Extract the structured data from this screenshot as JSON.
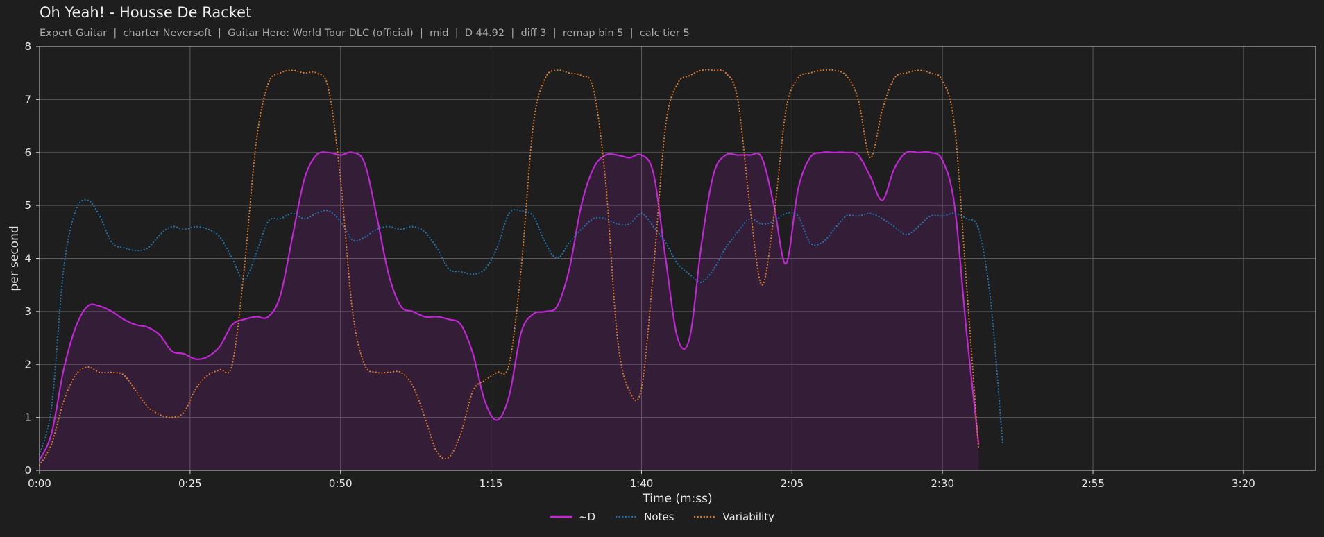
{
  "title": "Oh Yeah! - Housse De Racket",
  "subtitle": "Expert Guitar  |  charter Neversoft  |  Guitar Hero: World Tour DLC (official)  |  mid  |  D 44.92  |  diff 3  |  remap bin 5  |  calc tier 5",
  "chart_data": {
    "type": "line",
    "xlabel": "Time (m:ss)",
    "ylabel": "per second",
    "xlim": [
      0,
      212
    ],
    "ylim": [
      0,
      8
    ],
    "xticks": [
      0,
      25,
      50,
      75,
      100,
      125,
      150,
      175,
      200
    ],
    "xtick_labels": [
      "0:00",
      "0:25",
      "0:50",
      "1:15",
      "1:40",
      "2:05",
      "2:30",
      "2:55",
      "3:20"
    ],
    "yticks": [
      0,
      1,
      2,
      3,
      4,
      5,
      6,
      7,
      8
    ],
    "grid": true,
    "legend_position": "bottom-center",
    "x": [
      0,
      2,
      4,
      6,
      8,
      10,
      12,
      14,
      16,
      18,
      20,
      22,
      24,
      26,
      28,
      30,
      32,
      34,
      36,
      38,
      40,
      42,
      44,
      46,
      48,
      50,
      52,
      54,
      56,
      58,
      60,
      62,
      64,
      66,
      68,
      70,
      72,
      74,
      76,
      78,
      80,
      82,
      84,
      86,
      88,
      90,
      92,
      94,
      96,
      98,
      100,
      102,
      104,
      106,
      108,
      110,
      112,
      114,
      116,
      118,
      120,
      122,
      124,
      126,
      128,
      130,
      132,
      134,
      136,
      138,
      140,
      142,
      144,
      146,
      148,
      150,
      152,
      154,
      156,
      158,
      160,
      162,
      164,
      166,
      168,
      170,
      172,
      174,
      176,
      178,
      180,
      182,
      184,
      186,
      188,
      190,
      192,
      194,
      196,
      198,
      200,
      202,
      204,
      206,
      208,
      210,
      212
    ],
    "series": [
      {
        "name": "~D",
        "color": "#c026d3",
        "style": "solid",
        "fill": true,
        "values": [
          0.2,
          0.7,
          1.9,
          2.7,
          3.1,
          3.1,
          3.0,
          2.85,
          2.75,
          2.7,
          2.55,
          2.25,
          2.2,
          2.1,
          2.15,
          2.35,
          2.75,
          2.85,
          2.9,
          2.9,
          3.3,
          4.4,
          5.5,
          5.95,
          6.0,
          5.95,
          6.0,
          5.8,
          4.8,
          3.7,
          3.1,
          3.0,
          2.9,
          2.9,
          2.85,
          2.75,
          2.2,
          1.3,
          0.95,
          1.4,
          2.6,
          2.95,
          3.0,
          3.1,
          3.8,
          5.0,
          5.7,
          5.95,
          5.95,
          5.9,
          5.95,
          5.6,
          4.0,
          2.5,
          2.5,
          4.3,
          5.6,
          5.95,
          5.95,
          5.95,
          5.9,
          5.0,
          3.9,
          5.3,
          5.9,
          6.0,
          6.0,
          6.0,
          5.95,
          5.55,
          5.1,
          5.7,
          6.0,
          6.0,
          6.0,
          5.85,
          5.0,
          2.6,
          0.5
        ]
      },
      {
        "name": "Notes",
        "color": "#1f77b4",
        "style": "dotted",
        "fill": false,
        "values": [
          0.3,
          1.2,
          3.8,
          4.9,
          5.1,
          4.8,
          4.3,
          4.2,
          4.15,
          4.2,
          4.45,
          4.6,
          4.55,
          4.6,
          4.55,
          4.4,
          4.0,
          3.6,
          4.1,
          4.7,
          4.75,
          4.85,
          4.75,
          4.85,
          4.9,
          4.7,
          4.35,
          4.4,
          4.55,
          4.6,
          4.55,
          4.6,
          4.5,
          4.2,
          3.8,
          3.75,
          3.7,
          3.8,
          4.2,
          4.85,
          4.9,
          4.8,
          4.3,
          4.0,
          4.3,
          4.55,
          4.75,
          4.75,
          4.65,
          4.65,
          4.85,
          4.6,
          4.3,
          3.9,
          3.7,
          3.55,
          3.8,
          4.2,
          4.5,
          4.75,
          4.65,
          4.7,
          4.85,
          4.8,
          4.3,
          4.3,
          4.55,
          4.8,
          4.8,
          4.85,
          4.75,
          4.6,
          4.45,
          4.6,
          4.8,
          4.8,
          4.85,
          4.75,
          4.55,
          3.2,
          0.5
        ]
      },
      {
        "name": "Variability",
        "color": "#e07b27",
        "style": "dotted",
        "fill": false,
        "values": [
          0.1,
          0.5,
          1.3,
          1.8,
          1.95,
          1.85,
          1.85,
          1.8,
          1.5,
          1.2,
          1.05,
          1.0,
          1.1,
          1.55,
          1.8,
          1.9,
          2.0,
          3.8,
          6.2,
          7.3,
          7.5,
          7.55,
          7.5,
          7.5,
          7.2,
          5.5,
          3.0,
          2.0,
          1.85,
          1.85,
          1.85,
          1.6,
          1.0,
          0.35,
          0.25,
          0.7,
          1.5,
          1.7,
          1.85,
          2.0,
          3.8,
          6.5,
          7.4,
          7.55,
          7.5,
          7.45,
          7.2,
          5.5,
          2.5,
          1.5,
          1.55,
          3.8,
          6.5,
          7.3,
          7.45,
          7.55,
          7.55,
          7.5,
          7.0,
          5.0,
          3.5,
          4.8,
          6.8,
          7.4,
          7.5,
          7.55,
          7.55,
          7.45,
          7.0,
          5.9,
          6.8,
          7.4,
          7.5,
          7.55,
          7.5,
          7.35,
          6.5,
          3.5,
          0.4
        ]
      }
    ]
  }
}
